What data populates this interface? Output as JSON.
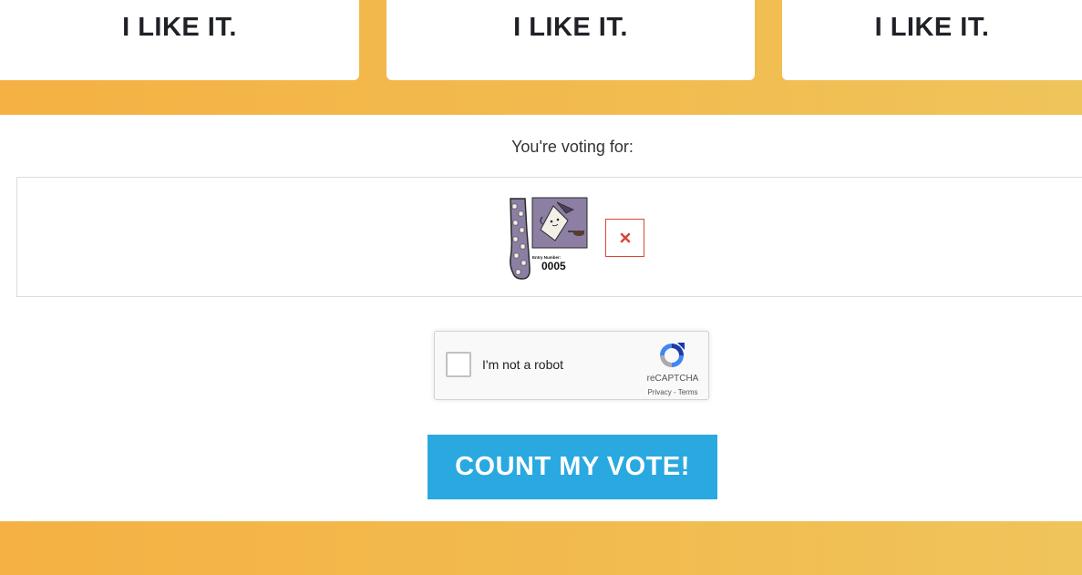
{
  "like_cards": [
    {
      "label": "I LIKE IT."
    },
    {
      "label": "I LIKE IT."
    },
    {
      "label": "I LIKE IT."
    }
  ],
  "voting": {
    "label": "You're voting for:",
    "entry": {
      "entry_label": "Entry Number:",
      "entry_number": "0005"
    },
    "remove_icon": "close-x-icon"
  },
  "recaptcha": {
    "label": "I'm not a robot",
    "brand": "reCAPTCHA",
    "privacy": "Privacy",
    "separator": " - ",
    "terms": "Terms"
  },
  "submit": {
    "label": "COUNT MY VOTE!"
  },
  "colors": {
    "band": "#f5b143",
    "button": "#2aa8e0",
    "remove": "#d9473c"
  }
}
